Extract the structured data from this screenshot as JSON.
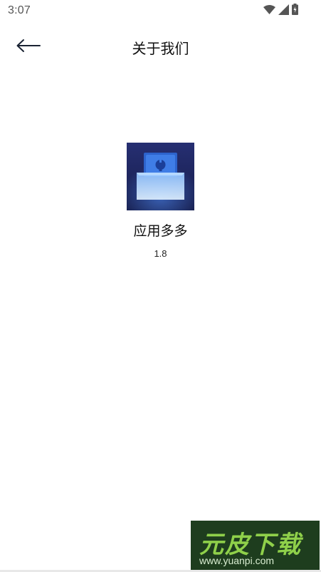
{
  "status_bar": {
    "time": "3:07",
    "icons": [
      "wifi-icon",
      "signal-icon",
      "battery-icon"
    ]
  },
  "app_bar": {
    "title": "关于我们",
    "back_icon": "arrow-left-icon"
  },
  "about": {
    "app_name": "应用多多",
    "version": "1.8"
  },
  "watermark": {
    "text": "元皮下载",
    "url": "www.yuanpi.com"
  },
  "colors": {
    "logo_bg": "#1f2a6b",
    "logo_accent": "#3f7de6",
    "watermark_bg": "#1e3d1e",
    "watermark_text": "#8fd04a"
  }
}
